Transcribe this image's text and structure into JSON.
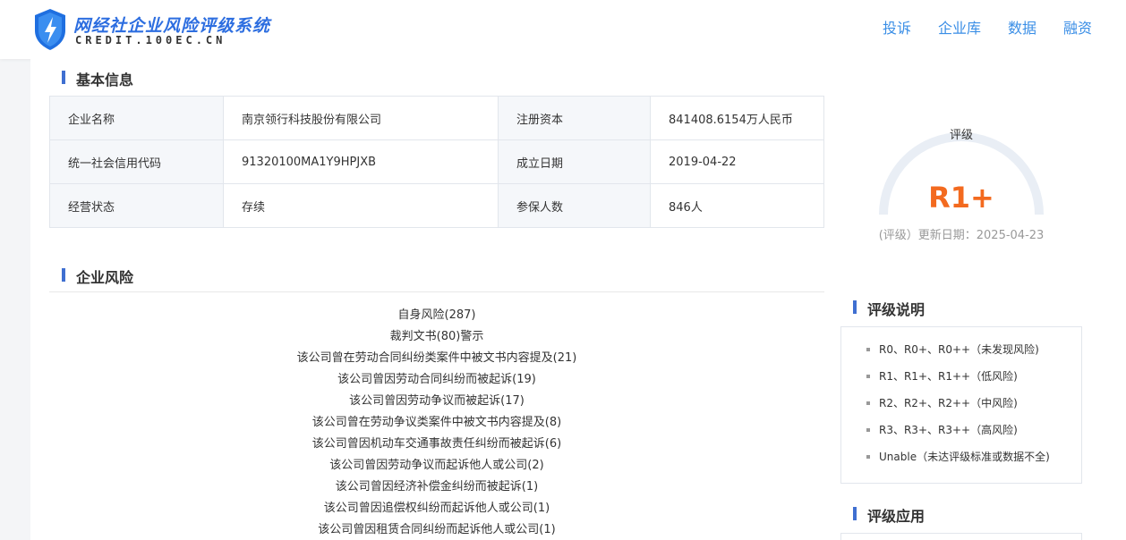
{
  "header": {
    "logo_text": "网经社企业风险评级系统",
    "logo_sub": "CREDIT.100EC.CN",
    "nav": [
      "投诉",
      "企业库",
      "数据",
      "融资"
    ]
  },
  "basic_info": {
    "title": "基本信息",
    "rows": [
      [
        "企业名称",
        "南京领行科技股份有限公司",
        "注册资本",
        "841408.6154万人民币"
      ],
      [
        "统一社会信用代码",
        "91320100MA1Y9HPJXB",
        "成立日期",
        "2019-04-22"
      ],
      [
        "经营状态",
        "存续",
        "参保人数",
        "846人"
      ]
    ]
  },
  "rating": {
    "label": "评级",
    "value": "R1+",
    "update": "(评级）更新日期：2025-04-23",
    "value_color": "#f36a1f"
  },
  "risk": {
    "title": "企业风险",
    "items": [
      "自身风险(287)",
      "裁判文书(80)警示",
      "该公司曾在劳动合同纠纷类案件中被文书内容提及(21)",
      "该公司曾因劳动合同纠纷而被起诉(19)",
      "该公司曾因劳动争议而被起诉(17)",
      "该公司曾在劳动争议类案件中被文书内容提及(8)",
      "该公司曾因机动车交通事故责任纠纷而被起诉(6)",
      "该公司曾因劳动争议而起诉他人或公司(2)",
      "该公司曾因经济补偿金纠纷而被起诉(1)",
      "该公司曾因追偿权纠纷而起诉他人或公司(1)",
      "该公司曾因租赁合同纠纷而起诉他人或公司(1)"
    ]
  },
  "rating_desc": {
    "title": "评级说明",
    "items": [
      "R0、R0+、R0++（未发现风险)",
      "R1、R1+、R1++（低风险)",
      "R2、R2+、R2++（中风险)",
      "R3、R3+、R3++（高风险)",
      "Unable（未达评级标准或数据不全)"
    ]
  },
  "rating_app": {
    "title": "评级应用"
  }
}
